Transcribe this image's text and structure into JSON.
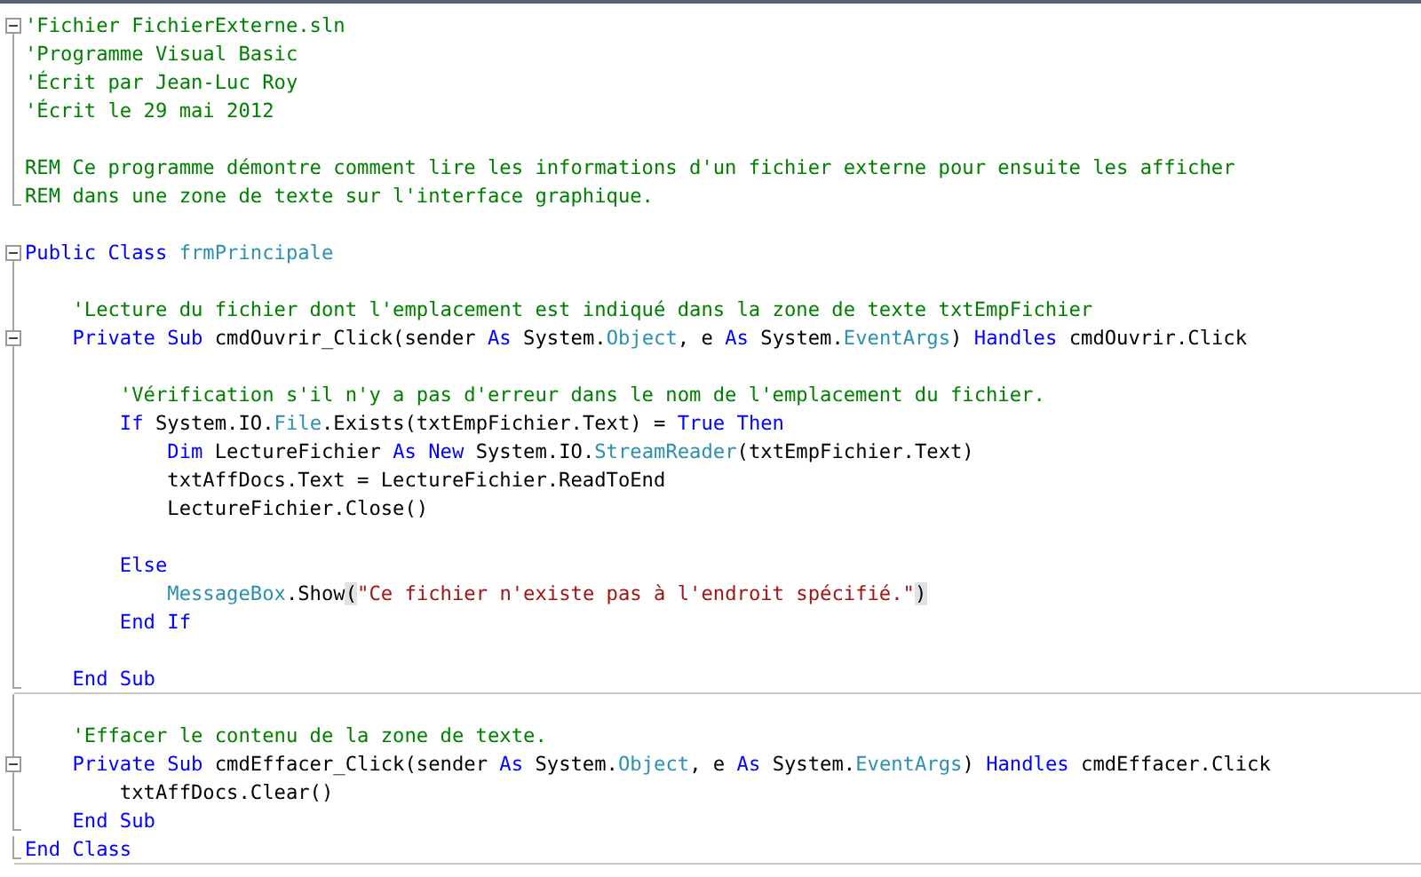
{
  "lines": [
    {
      "kind": "code",
      "expanded": true,
      "tokens": [
        {
          "text": "'Fichier FichierExterne.sln",
          "color": "#008000"
        }
      ]
    },
    {
      "kind": "code",
      "tokens": [
        {
          "text": "'Programme Visual Basic",
          "color": "#008000"
        }
      ]
    },
    {
      "kind": "code",
      "tokens": [
        {
          "text": "'Écrit par Jean-Luc Roy",
          "color": "#008000"
        }
      ]
    },
    {
      "kind": "code",
      "tokens": [
        {
          "text": "'Écrit le 29 mai 2012",
          "color": "#008000"
        }
      ]
    },
    {
      "kind": "blank"
    },
    {
      "kind": "code",
      "tokens": [
        {
          "text": "REM Ce programme démontre comment lire les informations d'un fichier externe pour ensuite les afficher",
          "color": "#008000"
        }
      ]
    },
    {
      "kind": "code",
      "fold_end": true,
      "tokens": [
        {
          "text": "REM dans une zone de texte sur l'interface graphique.",
          "color": "#008000"
        }
      ]
    },
    {
      "kind": "blank"
    },
    {
      "kind": "code",
      "expanded": true,
      "tokens": [
        {
          "text": "Public Class ",
          "color": "#0000ff"
        },
        {
          "text": "frmPrincipale",
          "color": "#2b91af"
        }
      ]
    },
    {
      "kind": "blank"
    },
    {
      "kind": "code",
      "tokens": [
        {
          "text": "    'Lecture du fichier dont l'emplacement est indiqué dans la zone de texte txtEmpFichier",
          "color": "#008000"
        }
      ]
    },
    {
      "kind": "code",
      "expanded": true,
      "tokens": [
        {
          "text": "    Private Sub ",
          "color": "#0000ff"
        },
        {
          "text": "cmdOuvrir_Click(sender ",
          "color": "#000000"
        },
        {
          "text": "As ",
          "color": "#0000ff"
        },
        {
          "text": "System.",
          "color": "#000000"
        },
        {
          "text": "Object",
          "color": "#2b91af"
        },
        {
          "text": ", e ",
          "color": "#000000"
        },
        {
          "text": "As ",
          "color": "#0000ff"
        },
        {
          "text": "System.",
          "color": "#000000"
        },
        {
          "text": "EventArgs",
          "color": "#2b91af"
        },
        {
          "text": ") ",
          "color": "#000000"
        },
        {
          "text": "Handles ",
          "color": "#0000ff"
        },
        {
          "text": "cmdOuvrir.Click",
          "color": "#000000"
        }
      ]
    },
    {
      "kind": "blank"
    },
    {
      "kind": "code",
      "tokens": [
        {
          "text": "        'Vérification s'il n'y a pas d'erreur dans le nom de l'emplacement du fichier.",
          "color": "#008000"
        }
      ]
    },
    {
      "kind": "code",
      "tokens": [
        {
          "text": "        If ",
          "color": "#0000ff"
        },
        {
          "text": "System.IO.",
          "color": "#000000"
        },
        {
          "text": "File",
          "color": "#2b91af"
        },
        {
          "text": ".Exists(txtEmpFichier.Text) = ",
          "color": "#000000"
        },
        {
          "text": "True Then",
          "color": "#0000ff"
        }
      ]
    },
    {
      "kind": "code",
      "tokens": [
        {
          "text": "            Dim ",
          "color": "#0000ff"
        },
        {
          "text": "LectureFichier ",
          "color": "#000000"
        },
        {
          "text": "As New ",
          "color": "#0000ff"
        },
        {
          "text": "System.IO.",
          "color": "#000000"
        },
        {
          "text": "StreamReader",
          "color": "#2b91af"
        },
        {
          "text": "(txtEmpFichier.Text)",
          "color": "#000000"
        }
      ]
    },
    {
      "kind": "code",
      "tokens": [
        {
          "text": "            txtAffDocs.Text = LectureFichier.ReadToEnd",
          "color": "#000000"
        }
      ]
    },
    {
      "kind": "code",
      "tokens": [
        {
          "text": "            LectureFichier.Close()",
          "color": "#000000"
        }
      ]
    },
    {
      "kind": "blank"
    },
    {
      "kind": "code",
      "tokens": [
        {
          "text": "        Else",
          "color": "#0000ff"
        }
      ]
    },
    {
      "kind": "code",
      "tokens": [
        {
          "text": "            MessageBox",
          "color": "#2b91af"
        },
        {
          "text": ".Show",
          "color": "#000000"
        },
        {
          "text": "(",
          "color": "#000000",
          "highlight": true
        },
        {
          "text": "\"Ce fichier n'existe pas à l'endroit spécifié.\"",
          "color": "#a31515"
        },
        {
          "text": ")",
          "color": "#000000",
          "highlight": true
        }
      ]
    },
    {
      "kind": "code",
      "tokens": [
        {
          "text": "        End If",
          "color": "#0000ff"
        }
      ]
    },
    {
      "kind": "blank"
    },
    {
      "kind": "code",
      "fold_end": true,
      "separator": true,
      "tokens": [
        {
          "text": "    End Sub",
          "color": "#0000ff"
        }
      ]
    },
    {
      "kind": "blank"
    },
    {
      "kind": "code",
      "tokens": [
        {
          "text": "    'Effacer le contenu de la zone de texte.",
          "color": "#008000"
        }
      ]
    },
    {
      "kind": "code",
      "expanded": true,
      "tokens": [
        {
          "text": "    Private Sub ",
          "color": "#0000ff"
        },
        {
          "text": "cmdEffacer_Click(sender ",
          "color": "#000000"
        },
        {
          "text": "As ",
          "color": "#0000ff"
        },
        {
          "text": "System.",
          "color": "#000000"
        },
        {
          "text": "Object",
          "color": "#2b91af"
        },
        {
          "text": ", e ",
          "color": "#000000"
        },
        {
          "text": "As ",
          "color": "#0000ff"
        },
        {
          "text": "System.",
          "color": "#000000"
        },
        {
          "text": "EventArgs",
          "color": "#2b91af"
        },
        {
          "text": ") ",
          "color": "#000000"
        },
        {
          "text": "Handles ",
          "color": "#0000ff"
        },
        {
          "text": "cmdEffacer.Click",
          "color": "#000000"
        }
      ]
    },
    {
      "kind": "code",
      "tokens": [
        {
          "text": "        txtAffDocs.Clear()",
          "color": "#000000"
        }
      ]
    },
    {
      "kind": "code",
      "fold_end": true,
      "tokens": [
        {
          "text": "    End Sub",
          "color": "#0000ff"
        }
      ]
    },
    {
      "kind": "code",
      "fold_end": true,
      "separator": true,
      "tokens": [
        {
          "text": "End Class",
          "color": "#0000ff"
        }
      ]
    }
  ]
}
